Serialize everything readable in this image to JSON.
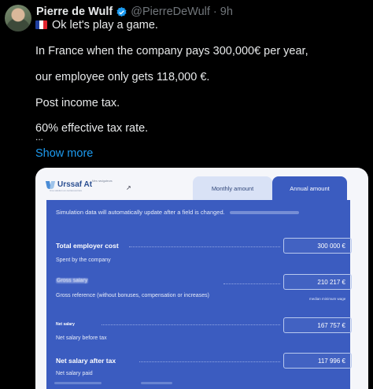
{
  "tweet": {
    "author_name": "Pierre de Wulf",
    "handle": "@PierreDeWulf",
    "separator": "·",
    "time": "9h",
    "lines": [
      "Ok let's play a game.",
      "In France when the company pays 300,000€ per year,",
      "our employee only gets 118,000 €.",
      "Post income tax.",
      "60% effective tax rate.",
      "..."
    ],
    "show_more": "Show more",
    "colors": {
      "link": "#1d9bf0",
      "verified": "#1d9bf0"
    }
  },
  "simulator": {
    "logo": "Urssaf At",
    "logo_sub": "Une solution en carréouverture",
    "tiny_note": "Mes navigateurs",
    "tabs": [
      {
        "label": "Monthly amount",
        "active": false
      },
      {
        "label": "Annual amount",
        "active": true
      }
    ],
    "notice": "Simulation data will automatically update after a field is changed.",
    "rows": [
      {
        "label": "Total employer cost",
        "sub": "Spent by the company",
        "value": "300 000 €"
      },
      {
        "label": "Gross salary",
        "sub": "Gross reference (without bonuses, compensation or increases)",
        "value": "210 217 €",
        "note": "median minimum wage"
      },
      {
        "label": "Net salary",
        "sub": "Net salary before tax",
        "value": "167 757 €"
      },
      {
        "label": "Net salary after tax",
        "sub": "Net salary paid",
        "value": "117 996 €"
      }
    ],
    "colors": {
      "panel": "#3b5cc0",
      "tab_inactive": "#d9e2f6"
    }
  }
}
